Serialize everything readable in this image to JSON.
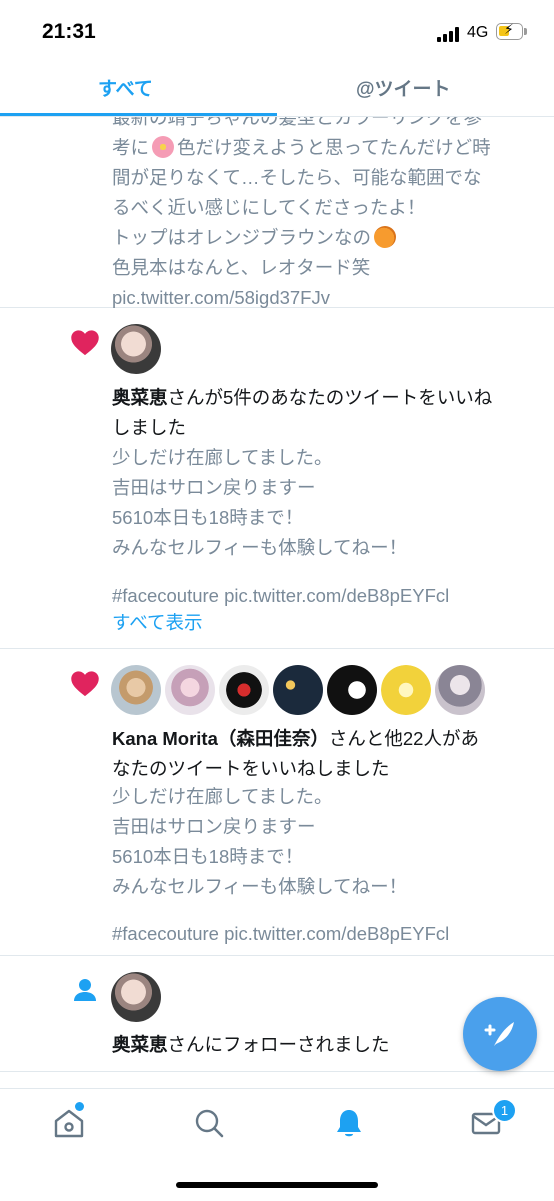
{
  "status_bar": {
    "time": "21:31",
    "network": "4G"
  },
  "tabs": [
    {
      "label": "すべて",
      "active": true
    },
    {
      "label": "@ツイート",
      "active": false
    }
  ],
  "partial_tweet": {
    "lines": [
      "最新の靖子ちゃんの髪型とカラーリングを参",
      "考に",
      "色だけ変えようと思ってたんだけど時",
      "間が足りなくて…そしたら、可能な範囲でな",
      "るべく近い感じにしてくださったよ！",
      "トップはオレンジブラウンなの",
      "色見本はなんと、レオタード笑",
      "pic.twitter.com/58igd37FJv"
    ]
  },
  "notif_like_single": {
    "user": "奥菜恵",
    "action_line1": "さんが5件のあなたのツイートをいいね",
    "action_line2": "しました",
    "tweet_lines": [
      "少しだけ在廊してました。",
      "吉田はサロン戻りますー",
      "5610本日も18時まで！",
      "みんなセルフィーも体験してねー！",
      "#facecouture pic.twitter.com/deB8pEYFcl"
    ],
    "show_all": "すべて表示"
  },
  "notif_like_multi": {
    "user": "Kana Morita（森田佳奈）",
    "action_line1": "さんと他22人があ",
    "action_line2": "なたのツイートをいいねしました",
    "tweet_lines": [
      "少しだけ在廊してました。",
      "吉田はサロン戻りますー",
      "5610本日も18時まで！",
      "みんなセルフィーも体験してねー！",
      "#facecouture pic.twitter.com/deB8pEYFcl"
    ]
  },
  "notif_follow": {
    "user": "奥菜恵",
    "action": "さんにフォローされました"
  },
  "bottom_nav": {
    "items": [
      {
        "icon": "home-icon"
      },
      {
        "icon": "search-icon"
      },
      {
        "icon": "notifications-bell-icon",
        "active": true
      },
      {
        "icon": "messages-envelope-icon"
      }
    ],
    "messages_badge": "1"
  },
  "colors": {
    "accent": "#1da1f2",
    "like": "#e0245e",
    "muted_text": "#7a8a99"
  }
}
